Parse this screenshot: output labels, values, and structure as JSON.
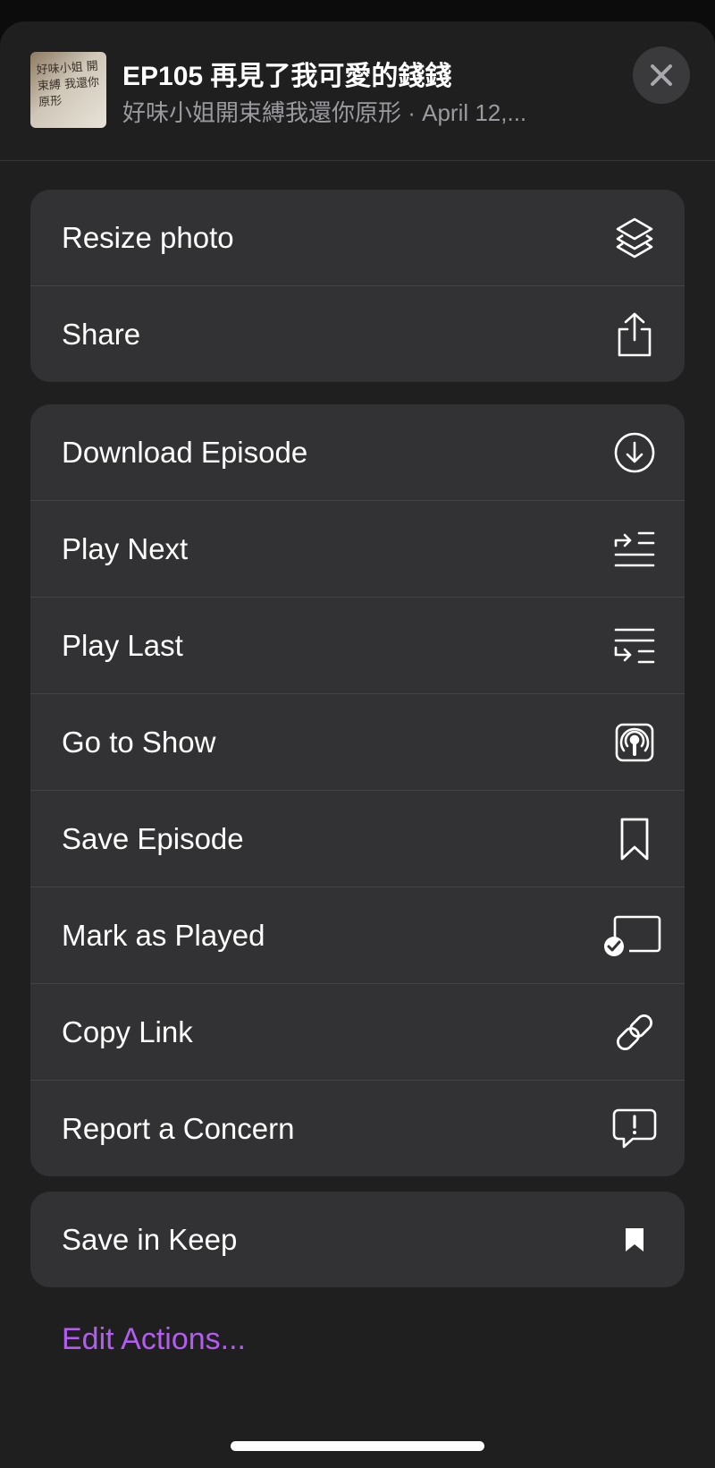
{
  "header": {
    "episode_title": "EP105 再見了我可愛的錢錢",
    "subtitle": "好味小姐開束縛我還你原形 · April 12,...",
    "artwork_text": "好味小姐 開束縛 我還你原形"
  },
  "group1": [
    {
      "label": "Resize photo",
      "icon": "layers-icon"
    },
    {
      "label": "Share",
      "icon": "share-icon"
    }
  ],
  "group2": [
    {
      "label": "Download Episode",
      "icon": "download-circle-icon"
    },
    {
      "label": "Play Next",
      "icon": "play-next-icon"
    },
    {
      "label": "Play Last",
      "icon": "play-last-icon"
    },
    {
      "label": "Go to Show",
      "icon": "podcasts-icon"
    },
    {
      "label": "Save Episode",
      "icon": "bookmark-icon"
    },
    {
      "label": "Mark as Played",
      "icon": "mark-played-icon"
    },
    {
      "label": "Copy Link",
      "icon": "link-icon"
    },
    {
      "label": "Report a Concern",
      "icon": "report-icon"
    }
  ],
  "group3": [
    {
      "label": "Save in Keep",
      "icon": "bookmark-filled-icon"
    }
  ],
  "footer": {
    "edit_actions_label": "Edit Actions..."
  },
  "colors": {
    "accent": "#b45cf2",
    "sheet_bg": "#1f1f1f",
    "row_bg": "#323234"
  }
}
